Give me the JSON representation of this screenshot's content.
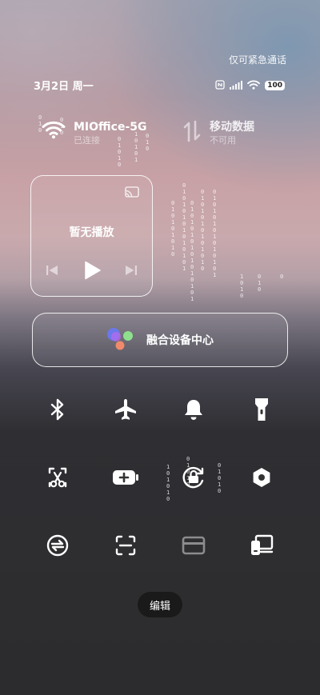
{
  "header": {
    "emergency_call": "仅可紧急通话",
    "date": "3月2日 周一",
    "battery": "100",
    "status_icons": [
      "nfc-icon",
      "signal-icon",
      "wifi-icon",
      "battery-icon"
    ]
  },
  "connectivity": {
    "wifi": {
      "title": "MIOffice-5G",
      "subtitle": "已连接",
      "icon": "wifi-icon",
      "state": "on"
    },
    "mobile_data": {
      "title": "移动数据",
      "subtitle": "不可用",
      "icon": "data-arrows-icon",
      "state": "disabled"
    }
  },
  "media": {
    "title": "暂无播放",
    "icons": [
      "cast-icon",
      "previous-icon",
      "play-icon",
      "next-icon"
    ]
  },
  "devices": {
    "label": "融合设备中心",
    "icon": "device-center-logo",
    "logo_colors": [
      "#6a78f0",
      "#b86af0",
      "#8ee08e",
      "#f08a6a"
    ]
  },
  "toggles": [
    {
      "icon": "bluetooth-icon",
      "state": "on"
    },
    {
      "icon": "airplane-icon",
      "state": "on"
    },
    {
      "icon": "bell-icon",
      "state": "on"
    },
    {
      "icon": "flashlight-icon",
      "state": "on"
    },
    {
      "icon": "screenshot-icon",
      "state": "on"
    },
    {
      "icon": "battery-saver-icon",
      "state": "on"
    },
    {
      "icon": "rotation-lock-icon",
      "state": "on"
    },
    {
      "icon": "settings-icon",
      "state": "on"
    },
    {
      "icon": "sync-icon",
      "state": "on"
    },
    {
      "icon": "scan-icon",
      "state": "on"
    },
    {
      "icon": "card-icon",
      "state": "disabled"
    },
    {
      "icon": "cast-screen-icon",
      "state": "on"
    }
  ],
  "edit": {
    "label": "编辑"
  },
  "matrix_digits": {
    "wifi_column_a": "0\n1\n0",
    "wifi_column_b": "0\n1\n0\n1\n0",
    "wifi_column_c": "0\n1\n0",
    "wifi_column_d": "1\n0\n1\n0\n1",
    "wifi_column_e": "0\n1\n0",
    "media_col_1": "0\n1\n0\n1\n0\n1\n0\n1\n0",
    "media_col_2": "0\n1\n0\n1\n0\n1\n0\n1\n0\n1\n0\n1\n0\n1",
    "media_col_3": "0\n1\n0\n1\n0\n1\n0\n1\n0\n1\n0\n1\n0\n1\n0\n1",
    "media_col_4": "0\n1\n0\n1\n0\n1\n0\n1\n0\n1\n0\n1\n0",
    "media_col_5": "0\n1\n0\n1\n0\n1\n0\n1\n0\n1\n0\n1\n0\n1",
    "media_col_6": "1\n0\n1\n0",
    "media_col_7": "0\n1\n0",
    "media_col_8": "0",
    "toggle_col_1": "1\n0\n1\n0\n1\n0",
    "toggle_col_2": "0\n1\n0\n1\n0",
    "toggle_col_3": "0\n1\n0\n1\n0"
  }
}
